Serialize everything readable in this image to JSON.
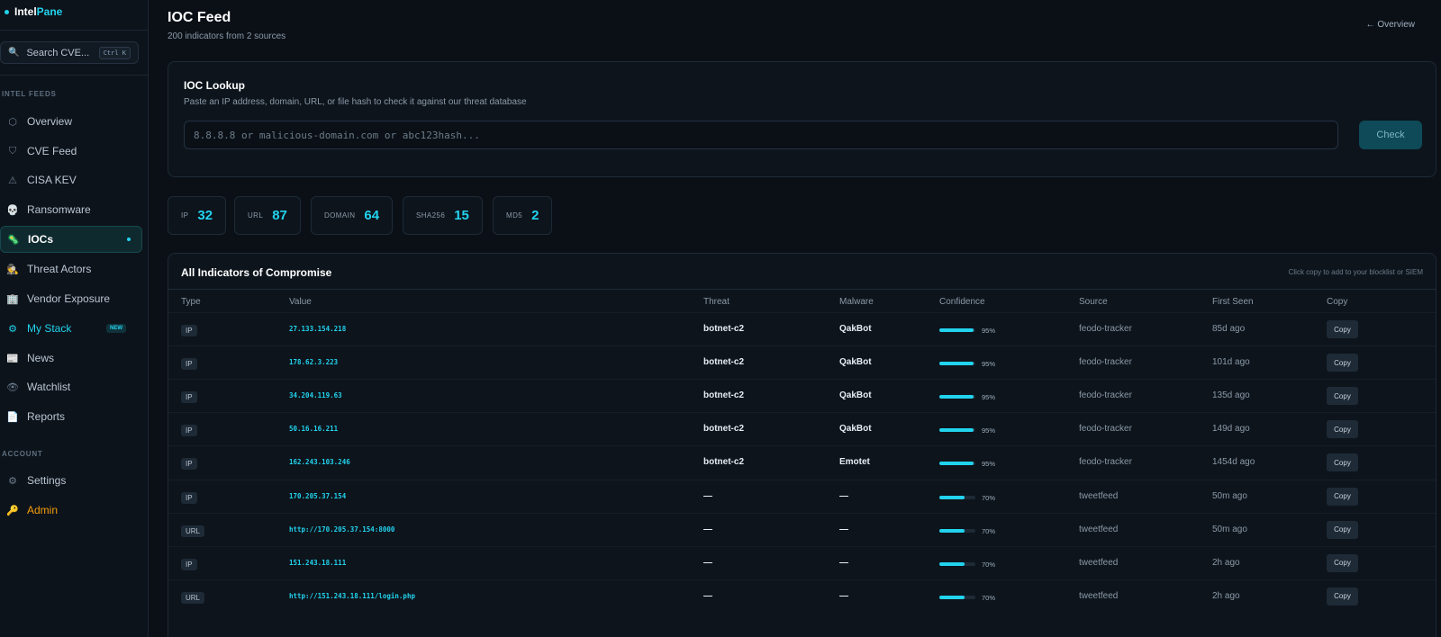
{
  "brand": {
    "name_a": "Intel",
    "name_b": "Pane"
  },
  "search": {
    "label": "Search CVE...",
    "shortcut": "Ctrl K"
  },
  "sidebar": {
    "section_feeds": "INTEL FEEDS",
    "section_account": "ACCOUNT",
    "items": [
      {
        "label": "Overview",
        "icon": "hexagon-icon"
      },
      {
        "label": "CVE Feed",
        "icon": "shield-icon"
      },
      {
        "label": "CISA KEV",
        "icon": "warning-icon"
      },
      {
        "label": "Ransomware",
        "icon": "skull-icon"
      },
      {
        "label": "IOCs",
        "icon": "bug-icon"
      },
      {
        "label": "Threat Actors",
        "icon": "spy-icon"
      },
      {
        "label": "Vendor Exposure",
        "icon": "building-icon"
      },
      {
        "label": "My Stack",
        "icon": "gear-icon",
        "badge": "NEW"
      },
      {
        "label": "News",
        "icon": "newspaper-icon"
      },
      {
        "label": "Watchlist",
        "icon": "eye-icon"
      },
      {
        "label": "Reports",
        "icon": "document-icon"
      }
    ],
    "account_items": [
      {
        "label": "Settings",
        "icon": "gear-icon"
      },
      {
        "label": "Admin",
        "icon": "key-icon"
      }
    ]
  },
  "header": {
    "title": "IOC Feed",
    "subtitle": "200 indicators from 2 sources",
    "back_link": "← Overview"
  },
  "lookup": {
    "title": "IOC Lookup",
    "description": "Paste an IP address, domain, URL, or file hash to check it against our threat database",
    "placeholder": "8.8.8.8 or malicious-domain.com or abc123hash...",
    "button": "Check"
  },
  "stats": [
    {
      "label": "IP",
      "value": "32"
    },
    {
      "label": "URL",
      "value": "87"
    },
    {
      "label": "DOMAIN",
      "value": "64"
    },
    {
      "label": "SHA256",
      "value": "15"
    },
    {
      "label": "MD5",
      "value": "2"
    }
  ],
  "table": {
    "title": "All Indicators of Compromise",
    "hint": "Click copy to add to your blocklist or SIEM",
    "columns": [
      "Type",
      "Value",
      "Threat",
      "Malware",
      "Confidence",
      "Source",
      "First Seen",
      "Copy"
    ],
    "rows": [
      {
        "type": "IP",
        "value": "27.133.154.218",
        "threat": "botnet-c2",
        "malware": "QakBot",
        "confidence": "95%",
        "confidence_level": 0.95,
        "source": "feodo-tracker",
        "first_seen": "85d ago",
        "copy": "Copy"
      },
      {
        "type": "IP",
        "value": "178.62.3.223",
        "threat": "botnet-c2",
        "malware": "QakBot",
        "confidence": "95%",
        "confidence_level": 0.95,
        "source": "feodo-tracker",
        "first_seen": "101d ago",
        "copy": "Copy"
      },
      {
        "type": "IP",
        "value": "34.204.119.63",
        "threat": "botnet-c2",
        "malware": "QakBot",
        "confidence": "95%",
        "confidence_level": 0.95,
        "source": "feodo-tracker",
        "first_seen": "135d ago",
        "copy": "Copy"
      },
      {
        "type": "IP",
        "value": "50.16.16.211",
        "threat": "botnet-c2",
        "malware": "QakBot",
        "confidence": "95%",
        "confidence_level": 0.95,
        "source": "feodo-tracker",
        "first_seen": "149d ago",
        "copy": "Copy"
      },
      {
        "type": "IP",
        "value": "162.243.103.246",
        "threat": "botnet-c2",
        "malware": "Emotet",
        "confidence": "95%",
        "confidence_level": 0.95,
        "source": "feodo-tracker",
        "first_seen": "1454d ago",
        "copy": "Copy"
      },
      {
        "type": "IP",
        "value": "170.205.37.154",
        "threat": "—",
        "malware": "—",
        "confidence": "70%",
        "confidence_level": 0.7,
        "source": "tweetfeed",
        "first_seen": "50m ago",
        "copy": "Copy"
      },
      {
        "type": "URL",
        "value": "http://170.205.37.154:8000",
        "threat": "—",
        "malware": "—",
        "confidence": "70%",
        "confidence_level": 0.7,
        "source": "tweetfeed",
        "first_seen": "50m ago",
        "copy": "Copy"
      },
      {
        "type": "IP",
        "value": "151.243.18.111",
        "threat": "—",
        "malware": "—",
        "confidence": "70%",
        "confidence_level": 0.7,
        "source": "tweetfeed",
        "first_seen": "2h ago",
        "copy": "Copy"
      },
      {
        "type": "URL",
        "value": "http://151.243.18.111/login.php",
        "threat": "—",
        "malware": "—",
        "confidence": "70%",
        "confidence_level": 0.7,
        "source": "tweetfeed",
        "first_seen": "2h ago",
        "copy": "Copy"
      }
    ]
  },
  "colors": {
    "accent": "#22d3ee",
    "admin": "#f59e0b",
    "background": "#0b1017"
  }
}
